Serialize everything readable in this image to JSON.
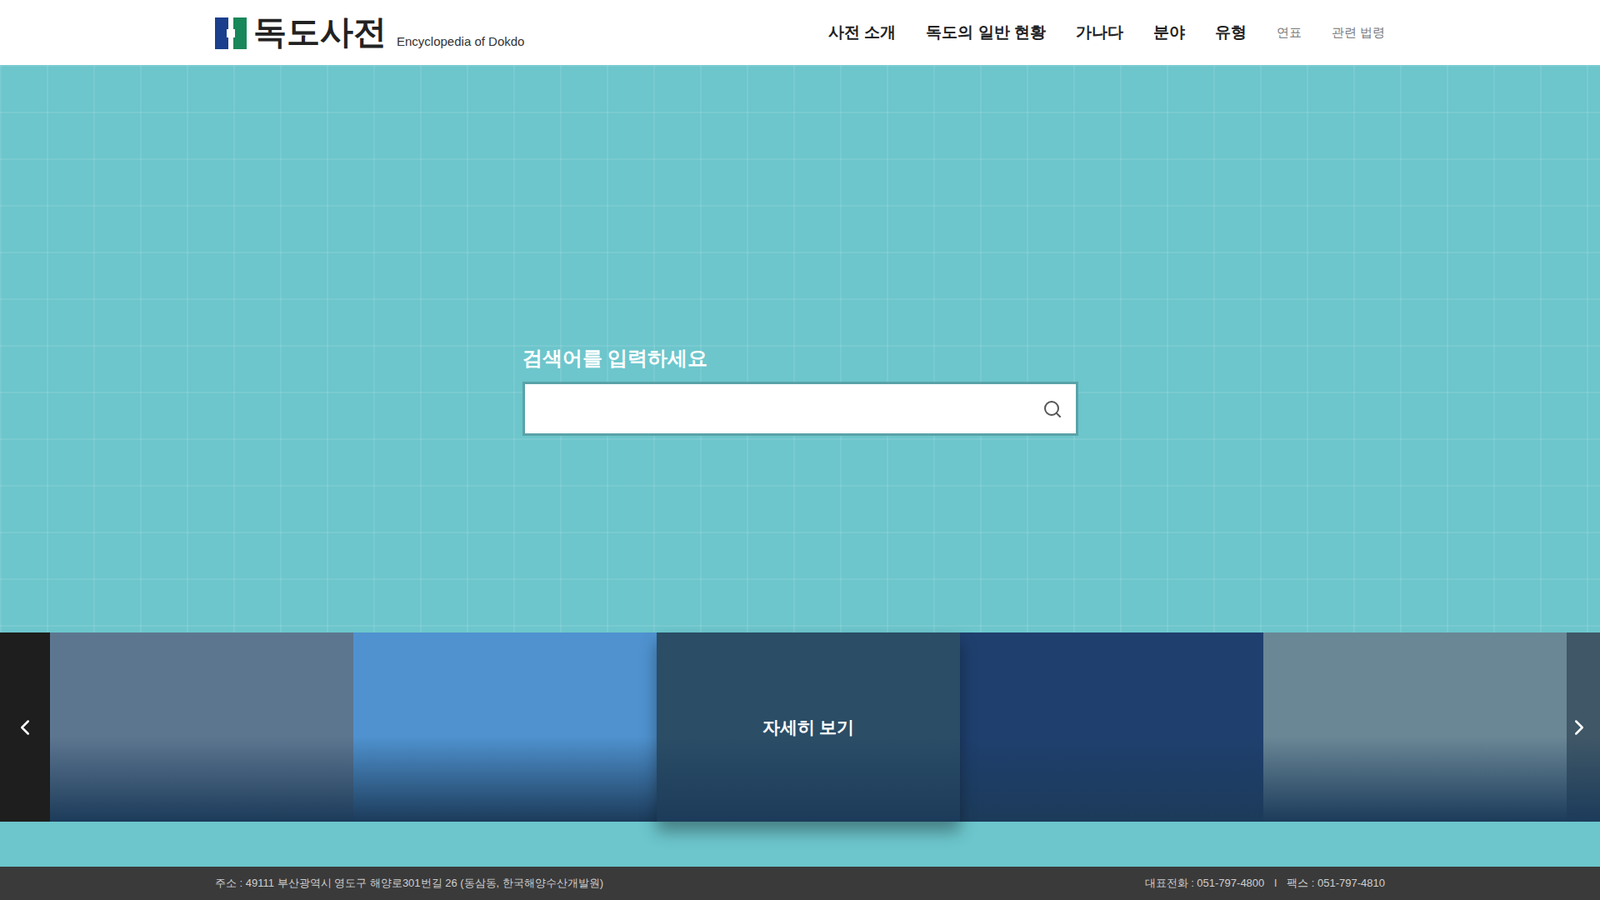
{
  "header": {
    "logo": {
      "title": "독도사전",
      "subtitle": "Encyclopedia of Dokdo"
    },
    "nav": [
      {
        "label": "사전 소개",
        "kind": "primary"
      },
      {
        "label": "독도의 일반 현황",
        "kind": "primary"
      },
      {
        "label": "가나다",
        "kind": "primary"
      },
      {
        "label": "분야",
        "kind": "primary"
      },
      {
        "label": "유형",
        "kind": "primary"
      },
      {
        "label": "연표",
        "kind": "secondary"
      },
      {
        "label": "관련 법령",
        "kind": "secondary"
      }
    ]
  },
  "search": {
    "label": "검색어를 입력하세요",
    "placeholder": ""
  },
  "carousel": {
    "slides": [
      {
        "hovered": false,
        "overlay": "",
        "color": "#5d7690"
      },
      {
        "hovered": false,
        "overlay": "",
        "color": "#4f92cf"
      },
      {
        "hovered": true,
        "overlay": "자세히 보기",
        "color": "#2b4d66"
      },
      {
        "hovered": false,
        "overlay": "",
        "color": "#1f3f6e"
      },
      {
        "hovered": false,
        "overlay": "",
        "color": "#6a8796"
      },
      {
        "hovered": false,
        "overlay": "",
        "color": "#3f5767"
      }
    ]
  },
  "footer": {
    "address": "주소 : 49111 부산광역시 영도구 해양로301번길 26 (동삼동, 한국해양수산개발원)",
    "phone": "대표전화 : 051-797-4800",
    "separator": "l",
    "fax": "팩스 : 051-797-4810"
  }
}
